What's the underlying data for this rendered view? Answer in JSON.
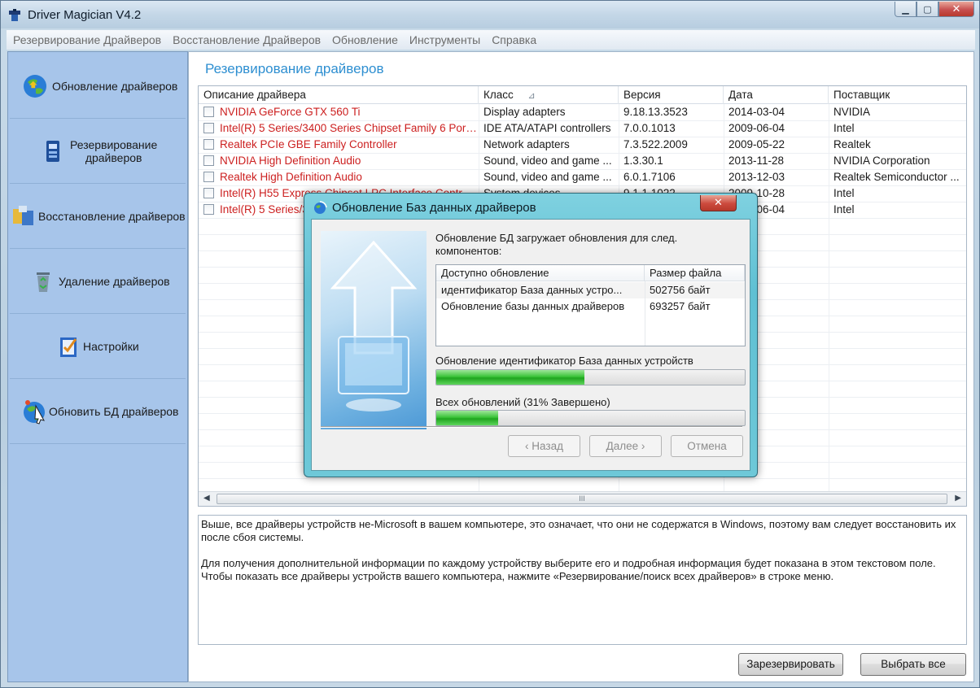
{
  "window": {
    "title": "Driver Magician V4.2"
  },
  "menu": [
    "Резервирование Драйверов",
    "Восстановление Драйверов",
    "Обновление",
    "Инструменты",
    "Справка"
  ],
  "sidebar": {
    "items": [
      {
        "label": "Обновление драйверов",
        "icon": "globe-update-icon"
      },
      {
        "label": "Резервирование\nдрайверов",
        "icon": "backup-icon"
      },
      {
        "label": "Восстановление драйверов",
        "icon": "restore-icon"
      },
      {
        "label": "Удаление драйверов",
        "icon": "recycle-bin-icon"
      },
      {
        "label": "Настройки",
        "icon": "settings-check-icon"
      },
      {
        "label": "Обновить БД драйверов",
        "icon": "globe-cursor-icon"
      }
    ]
  },
  "main": {
    "title": "Резервирование драйверов",
    "columns": [
      "Описание драйвера",
      "Класс",
      "Версия",
      "Дата",
      "Поставщик"
    ],
    "sort_indicator": "⊿",
    "rows": [
      {
        "name": "NVIDIA GeForce GTX 560 Ti",
        "class": "Display adapters",
        "version": "9.18.13.3523",
        "date": "2014-03-04",
        "vendor": "NVIDIA"
      },
      {
        "name": "Intel(R) 5 Series/3400 Series Chipset Family 6 Port S...",
        "class": "IDE ATA/ATAPI controllers",
        "version": "7.0.0.1013",
        "date": "2009-06-04",
        "vendor": "Intel"
      },
      {
        "name": "Realtek PCIe GBE Family Controller",
        "class": "Network adapters",
        "version": "7.3.522.2009",
        "date": "2009-05-22",
        "vendor": "Realtek"
      },
      {
        "name": "NVIDIA High Definition Audio",
        "class": "Sound, video and game ...",
        "version": "1.3.30.1",
        "date": "2013-11-28",
        "vendor": "NVIDIA Corporation"
      },
      {
        "name": "Realtek High Definition Audio",
        "class": "Sound, video and game ...",
        "version": "6.0.1.7106",
        "date": "2013-12-03",
        "vendor": "Realtek Semiconductor ..."
      },
      {
        "name": "Intel(R) H55 Express Chipset LPC Interface Controlle",
        "class": "System devices",
        "version": "9.1.1.1022",
        "date": "2009-10-28",
        "vendor": "Intel"
      },
      {
        "name": "Intel(R) 5 Series/3",
        "class": "",
        "version": "",
        "date": "2009-06-04",
        "vendor": "Intel"
      }
    ],
    "scroll_thumb_label": "III",
    "description_p1": "Выше, все драйверы устройств не-Microsoft в вашем компьютере, это означает, что они не содержатся в Windows, поэтому вам следует восстановить их после сбоя системы.",
    "description_p2": "Для получения дополнительной информации по каждому устройству выберите его и подробная информация будет показана в этом текстовом поле. Чтобы показать все драйверы устройств вашего компьютера, нажмите «Резервирование/поиск всех драйверов» в строке меню.",
    "buttons": {
      "backup": "Зарезервировать",
      "select_all": "Выбрать все"
    }
  },
  "dialog": {
    "title": "Обновление Баз данных драйверов",
    "intro": "Обновление БД загружает обновления для след. компонентов:",
    "list_columns": [
      "Доступно обновление",
      "Размер файла"
    ],
    "list_rows": [
      {
        "name": "идентификатор База данных устро...",
        "size": "502756 байт"
      },
      {
        "name": "Обновление базы данных драйверов",
        "size": "693257 байт"
      }
    ],
    "progress1_label": "Обновление идентификатор База данных устройств",
    "progress1_value": 0.48,
    "progress2_label": "Всех обновлений (31% Завершено)",
    "progress2_value": 0.2,
    "buttons": {
      "back": "‹ Назад",
      "next": "Далее ›",
      "cancel": "Отмена"
    }
  },
  "colors": {
    "accent_title": "#2e8fd1",
    "driver_name": "#cc1f1f",
    "sidebar_bg": "#a7c5ea",
    "progress_green": "#3cc43a"
  }
}
